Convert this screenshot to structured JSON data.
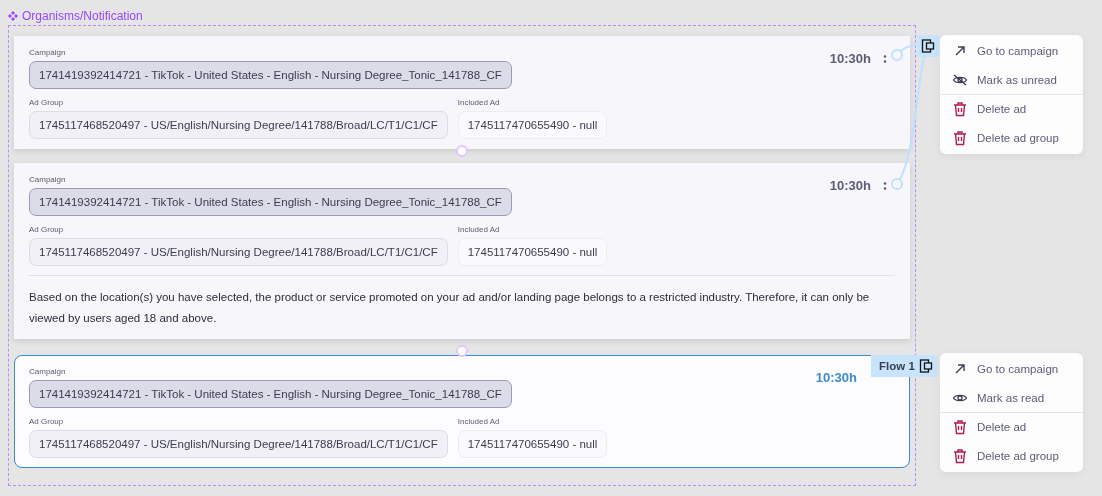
{
  "frame": {
    "title": "Organisms/Notification"
  },
  "notifications": [
    {
      "campaign_label": "Campaign",
      "campaign": "1741419392414721 - TikTok - United States - English - Nursing Degree_Tonic_141788_CF",
      "ad_group_label": "Ad Group",
      "ad_group": "1745117468520497 - US/English/Nursing Degree/141788/Broad/LC/T1/C1/CF",
      "included_ad_label": "Included Ad",
      "included_ad": "1745117470655490 - null",
      "time": "10:30h",
      "selected": false
    },
    {
      "campaign_label": "Campaign",
      "campaign": "1741419392414721 - TikTok - United States - English - Nursing Degree_Tonic_141788_CF",
      "ad_group_label": "Ad Group",
      "ad_group": "1745117468520497 - US/English/Nursing Degree/141788/Broad/LC/T1/C1/CF",
      "included_ad_label": "Included Ad",
      "included_ad": "1745117470655490 - null",
      "time": "10:30h",
      "message": "Based on the location(s) you have selected, the product or service promoted on your ad and/or landing page belongs to a restricted industry. Therefore, it can only be viewed by users aged 18 and above.",
      "selected": false
    },
    {
      "campaign_label": "Campaign",
      "campaign": "1741419392414721 - TikTok - United States - English - Nursing Degree_Tonic_141788_CF",
      "ad_group_label": "Ad Group",
      "ad_group": "1745117468520497 - US/English/Nursing Degree/141788/Broad/LC/T1/C1/CF",
      "included_ad_label": "Included Ad",
      "included_ad": "1745117470655490 - null",
      "time": "10:30h",
      "selected": true
    }
  ],
  "flow_tag": {
    "label": "Flow 1"
  },
  "menus": [
    {
      "items": [
        {
          "kind": "go",
          "label": "Go to campaign"
        },
        {
          "kind": "unread",
          "label": "Mark as unread"
        },
        {
          "kind": "delete",
          "label": "Delete ad"
        },
        {
          "kind": "delete",
          "label": "Delete ad group"
        }
      ]
    },
    {
      "items": [
        {
          "kind": "go",
          "label": "Go to campaign"
        },
        {
          "kind": "read",
          "label": "Mark as read"
        },
        {
          "kind": "delete",
          "label": "Delete ad"
        },
        {
          "kind": "delete",
          "label": "Delete ad group"
        }
      ]
    }
  ]
}
